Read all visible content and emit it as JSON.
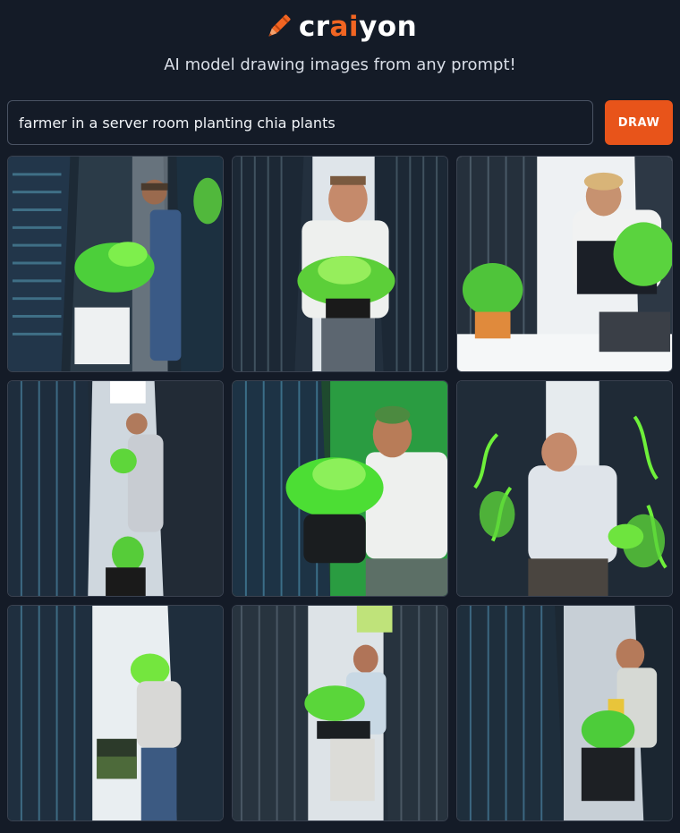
{
  "header": {
    "logo_text_prefix": "cr",
    "logo_text_accent": "ai",
    "logo_text_suffix": "yon",
    "tagline": "AI model drawing images from any prompt!"
  },
  "prompt": {
    "value": "farmer in a server room planting chia plants",
    "button_label": "DRAW"
  },
  "colors": {
    "accent": "#e8541a",
    "background": "#141b27"
  },
  "results": [
    {
      "id": "generated-image-1",
      "scene": "dark"
    },
    {
      "id": "generated-image-2",
      "scene": "dark"
    },
    {
      "id": "generated-image-3",
      "scene": "light"
    },
    {
      "id": "generated-image-4",
      "scene": "dark"
    },
    {
      "id": "generated-image-5",
      "scene": "green"
    },
    {
      "id": "generated-image-6",
      "scene": "dark"
    },
    {
      "id": "generated-image-7",
      "scene": "dark"
    },
    {
      "id": "generated-image-8",
      "scene": "dark"
    },
    {
      "id": "generated-image-9",
      "scene": "dark"
    }
  ]
}
